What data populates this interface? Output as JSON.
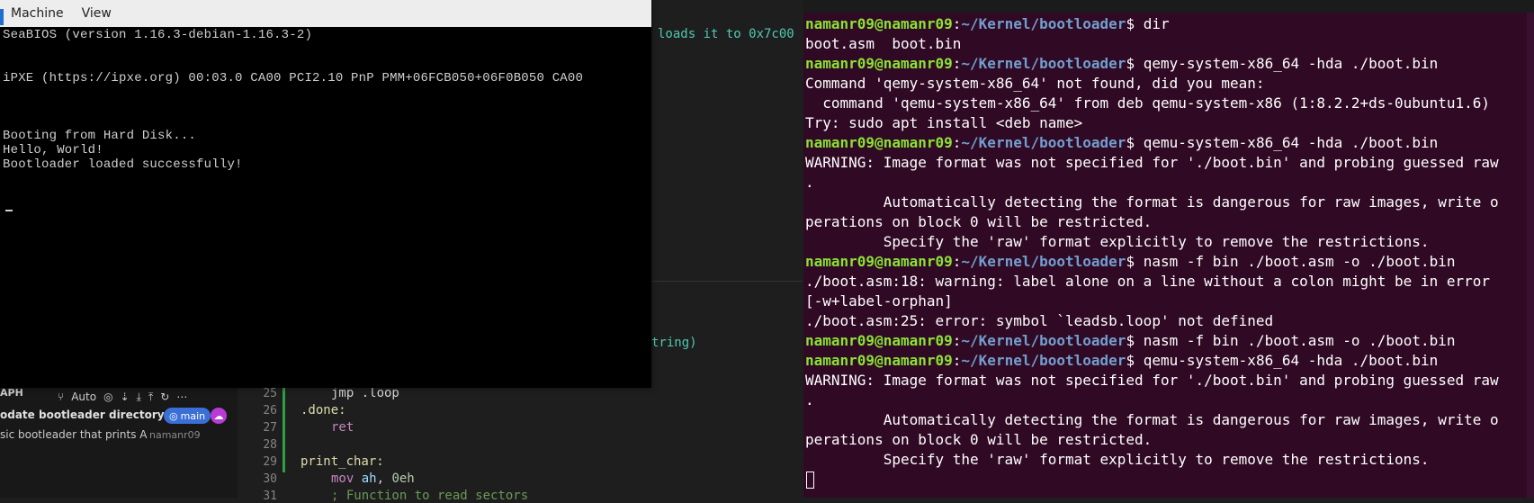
{
  "qemu": {
    "menu": [
      "Machine",
      "View"
    ],
    "screen_lines": [
      "SeaBIOS (version 1.16.3-debian-1.16.3-2)",
      "",
      "",
      "iPXE (https://ipxe.org) 00:03.0 CA00 PCI2.10 PnP PMM+06FCB050+06F0B050 CA00",
      "",
      "",
      "",
      "Booting from Hard Disk...",
      "Hello, World!",
      "Bootloader loaded successfully!"
    ]
  },
  "editor": {
    "faint_text_1": "loads it to 0x7c00",
    "faint_text_2": "tring)",
    "scm": {
      "header": "APH",
      "auto_label": "Auto",
      "commit_message": "odate bootleader directory ...",
      "branch": "main",
      "commit_description": "sic bootleader that prints A",
      "author": "namanr09"
    },
    "line_numbers": [
      "25",
      "26",
      "27",
      "28",
      "29",
      "30",
      "31"
    ],
    "code": {
      "l25": "jmp .loop",
      "l26": ".done:",
      "l27": "ret",
      "l29": "print_char:",
      "l30_op": "mov",
      "l30_reg": "ah",
      "l30_num": "0eh",
      "l31": "; Function to read sectors"
    }
  },
  "terminal": {
    "prompt_user": "namanr09@namanr09",
    "prompt_path": "~/Kernel/bootloader",
    "lines": [
      {
        "type": "prompt",
        "cmd": " dir"
      },
      {
        "type": "out",
        "text": "boot.asm  boot.bin"
      },
      {
        "type": "prompt",
        "cmd": " qemy-system-x86_64 -hda ./boot.bin"
      },
      {
        "type": "out",
        "text": "Command 'qemy-system-x86_64' not found, did you mean:"
      },
      {
        "type": "out",
        "text": "  command 'qemu-system-x86_64' from deb qemu-system-x86 (1:8.2.2+ds-0ubuntu1.6)"
      },
      {
        "type": "out",
        "text": "Try: sudo apt install <deb name>"
      },
      {
        "type": "prompt",
        "cmd": " qemu-system-x86_64 -hda ./boot.bin"
      },
      {
        "type": "out",
        "text": "WARNING: Image format was not specified for './boot.bin' and probing guessed raw"
      },
      {
        "type": "out",
        "text": "."
      },
      {
        "type": "out",
        "text": "         Automatically detecting the format is dangerous for raw images, write o"
      },
      {
        "type": "out",
        "text": "perations on block 0 will be restricted."
      },
      {
        "type": "out",
        "text": "         Specify the 'raw' format explicitly to remove the restrictions."
      },
      {
        "type": "prompt",
        "cmd": " nasm -f bin ./boot.asm -o ./boot.bin"
      },
      {
        "type": "out",
        "text": "./boot.asm:18: warning: label alone on a line without a colon might be in error"
      },
      {
        "type": "out",
        "text": "[-w+label-orphan]"
      },
      {
        "type": "out",
        "text": "./boot.asm:25: error: symbol `leadsb.loop' not defined"
      },
      {
        "type": "prompt",
        "cmd": " nasm -f bin ./boot.asm -o ./boot.bin"
      },
      {
        "type": "prompt",
        "cmd": " qemu-system-x86_64 -hda ./boot.bin"
      },
      {
        "type": "out",
        "text": "WARNING: Image format was not specified for './boot.bin' and probing guessed raw"
      },
      {
        "type": "out",
        "text": "."
      },
      {
        "type": "out",
        "text": "         Automatically detecting the format is dangerous for raw images, write o"
      },
      {
        "type": "out",
        "text": "perations on block 0 will be restricted."
      },
      {
        "type": "out",
        "text": "         Specify the 'raw' format explicitly to remove the restrictions."
      }
    ]
  },
  "colors": {
    "terminal_bg": "#300a24",
    "prompt_user": "#8ae234",
    "prompt_path": "#729fcf",
    "branch_badge": "#3a6fd6"
  }
}
